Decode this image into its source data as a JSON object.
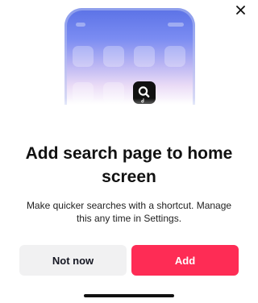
{
  "dialog": {
    "title": "Add search page to home screen",
    "description": "Make quicker searches with a shortcut. Manage this any time in Settings."
  },
  "buttons": {
    "secondary_label": "Not now",
    "primary_label": "Add"
  },
  "icons": {
    "close": "close-icon",
    "shortcut": "search-shortcut-icon"
  },
  "colors": {
    "primary": "#fe2c55",
    "secondary_bg": "#f1f1f2",
    "text": "#111111"
  }
}
